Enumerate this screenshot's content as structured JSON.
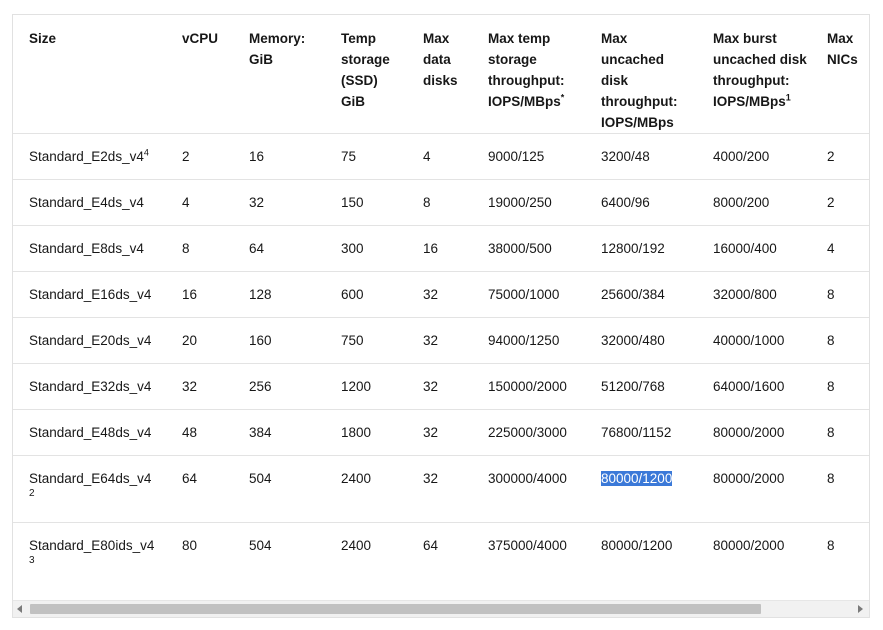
{
  "headers": [
    {
      "label": "Size",
      "sup": ""
    },
    {
      "label": "vCPU",
      "sup": ""
    },
    {
      "label": "Memory: GiB",
      "sup": ""
    },
    {
      "label": "Temp storage (SSD) GiB",
      "sup": ""
    },
    {
      "label": "Max data disks",
      "sup": ""
    },
    {
      "label": "Max temp storage throughput: IOPS/MBps",
      "sup": "*"
    },
    {
      "label": "Max uncached disk throughput: IOPS/MBps",
      "sup": ""
    },
    {
      "label": "Max burst uncached disk throughput: IOPS/MBps",
      "sup": "1"
    },
    {
      "label": "Max NICs",
      "sup": ""
    }
  ],
  "rows": [
    {
      "size": "Standard_E2ds_v4",
      "size_sup": "4",
      "size_sub": "",
      "vcpu": "2",
      "memory": "16",
      "temp": "75",
      "disks": "4",
      "temp_tp": "9000/125",
      "uncached": "3200/48",
      "burst": "4000/200",
      "nics": "2"
    },
    {
      "size": "Standard_E4ds_v4",
      "size_sup": "",
      "size_sub": "",
      "vcpu": "4",
      "memory": "32",
      "temp": "150",
      "disks": "8",
      "temp_tp": "19000/250",
      "uncached": "6400/96",
      "burst": "8000/200",
      "nics": "2"
    },
    {
      "size": "Standard_E8ds_v4",
      "size_sup": "",
      "size_sub": "",
      "vcpu": "8",
      "memory": "64",
      "temp": "300",
      "disks": "16",
      "temp_tp": "38000/500",
      "uncached": "12800/192",
      "burst": "16000/400",
      "nics": "4"
    },
    {
      "size": "Standard_E16ds_v4",
      "size_sup": "",
      "size_sub": "",
      "vcpu": "16",
      "memory": "128",
      "temp": "600",
      "disks": "32",
      "temp_tp": "75000/1000",
      "uncached": "25600/384",
      "burst": "32000/800",
      "nics": "8"
    },
    {
      "size": "Standard_E20ds_v4",
      "size_sup": "",
      "size_sub": "",
      "vcpu": "20",
      "memory": "160",
      "temp": "750",
      "disks": "32",
      "temp_tp": "94000/1250",
      "uncached": "32000/480",
      "burst": "40000/1000",
      "nics": "8"
    },
    {
      "size": "Standard_E32ds_v4",
      "size_sup": "",
      "size_sub": "",
      "vcpu": "32",
      "memory": "256",
      "temp": "1200",
      "disks": "32",
      "temp_tp": "150000/2000",
      "uncached": "51200/768",
      "burst": "64000/1600",
      "nics": "8"
    },
    {
      "size": "Standard_E48ds_v4",
      "size_sup": "",
      "size_sub": "",
      "vcpu": "48",
      "memory": "384",
      "temp": "1800",
      "disks": "32",
      "temp_tp": "225000/3000",
      "uncached": "76800/1152",
      "burst": "80000/2000",
      "nics": "8"
    },
    {
      "size": "Standard_E64ds_v4",
      "size_sup": "",
      "size_sub": "2",
      "vcpu": "64",
      "memory": "504",
      "temp": "2400",
      "disks": "32",
      "temp_tp": "300000/4000",
      "uncached": "80000/1200",
      "burst": "80000/2000",
      "nics": "8"
    },
    {
      "size": "Standard_E80ids_v4",
      "size_sup": "",
      "size_sub": "3",
      "vcpu": "80",
      "memory": "504",
      "temp": "2400",
      "disks": "64",
      "temp_tp": "375000/4000",
      "uncached": "80000/1200",
      "burst": "80000/2000",
      "nics": "8"
    }
  ],
  "selection": {
    "row": 7,
    "column": "uncached",
    "highlight_color": "#3b79d8"
  },
  "colors": {
    "border": "#e1e1e1",
    "scrollbar_track": "#f1f1f1",
    "scrollbar_thumb": "#c1c1c1"
  }
}
